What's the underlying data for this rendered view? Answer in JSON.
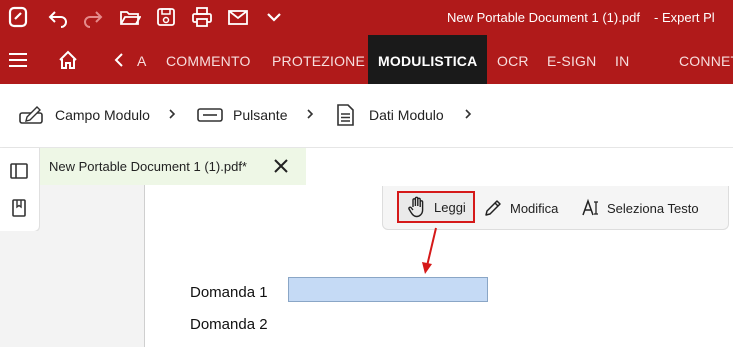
{
  "titlebar": {
    "document_title": "New Portable Document 1 (1).pdf",
    "app_title": "-  Expert Pl",
    "icons": [
      "app-logo-icon",
      "undo-icon",
      "redo-icon",
      "open-folder-icon",
      "save-icon",
      "print-icon",
      "mail-icon",
      "chevron-down-icon"
    ]
  },
  "ribbon": {
    "tabs": [
      {
        "label": "A"
      },
      {
        "label": "COMMENTO"
      },
      {
        "label": "PROTEZIONE"
      },
      {
        "label": "MODULISTICA",
        "active": true
      },
      {
        "label": "OCR"
      },
      {
        "label": "E-SIGN"
      },
      {
        "label": "IN"
      },
      {
        "label": "CONNETT"
      }
    ]
  },
  "subtoolbar": {
    "items": [
      {
        "label": "Campo Modulo",
        "icon": "form-field-icon"
      },
      {
        "label": "Pulsante",
        "icon": "button-icon"
      },
      {
        "label": "Dati Modulo",
        "icon": "form-data-icon"
      }
    ]
  },
  "document_tab": {
    "label": "New Portable Document 1 (1).pdf*"
  },
  "float_toolbar": {
    "buttons": [
      {
        "label": "Leggi",
        "icon": "hand-icon",
        "selected": true
      },
      {
        "label": "Modifica",
        "icon": "pencil-icon"
      },
      {
        "label": "Seleziona Testo",
        "icon": "select-text-icon"
      }
    ]
  },
  "form": {
    "question1": "Domanda 1",
    "question2": "Domanda 2"
  },
  "colors": {
    "brand_red": "#b01a1a",
    "active_tab": "#1a1a1a",
    "highlight_red": "#d51919",
    "field_fill": "#c5daf5",
    "doc_tab_bg": "#eef7e6"
  }
}
